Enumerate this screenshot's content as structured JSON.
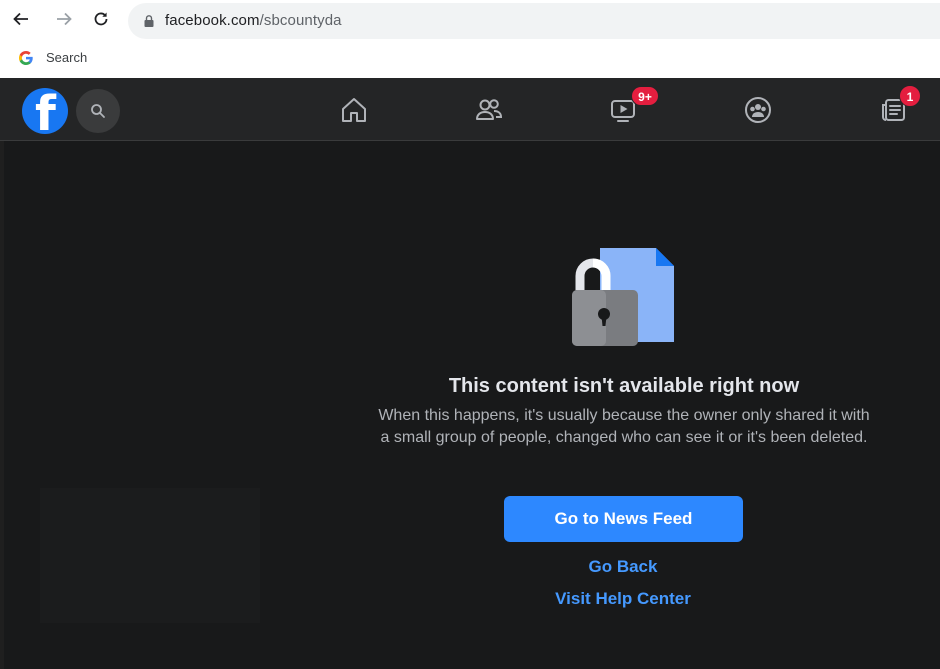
{
  "browser": {
    "url_domain": "facebook.com",
    "url_path": "/sbcountyda",
    "bookmark_label": "Search"
  },
  "topbar": {
    "watch_badge": "9+",
    "notifications_badge": "1"
  },
  "error": {
    "title": "This content isn't available right now",
    "body": "When this happens, it's usually because the owner only shared it with a small group of people, changed who can see it or it's been deleted.",
    "primary_button": "Go to News Feed",
    "go_back": "Go Back",
    "help_center": "Visit Help Center"
  },
  "colors": {
    "brand": "#1877f2",
    "primary_button": "#2d88ff",
    "link": "#4599ff",
    "badge": "#e41e3f",
    "page_background": "#18191a"
  },
  "icons": [
    "back-arrow-icon",
    "forward-arrow-icon",
    "reload-icon",
    "lock-icon",
    "google-icon",
    "facebook-logo-icon",
    "search-icon",
    "home-icon",
    "friends-icon",
    "watch-icon",
    "groups-icon",
    "news-icon",
    "locked-document-icon"
  ]
}
